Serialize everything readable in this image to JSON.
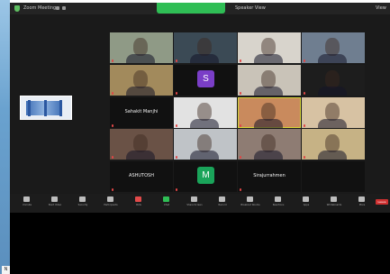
{
  "window": {
    "title": "Zoom Meeting",
    "speaker_view_label": "Speaker View",
    "view_label": "View"
  },
  "gallery": {
    "tiles": [
      {
        "kind": "video",
        "name": "",
        "bg": "#8f9a86"
      },
      {
        "kind": "video",
        "name": "",
        "bg": "#3b4a55"
      },
      {
        "kind": "video",
        "name": "",
        "bg": "#d8d4cc"
      },
      {
        "kind": "video",
        "name": "",
        "bg": "#6f7e90"
      },
      {
        "kind": "video",
        "name": "",
        "bg": "#a28a5c"
      },
      {
        "kind": "avatar",
        "initial": "S",
        "avatar_color": "#7a3ec7",
        "name": ""
      },
      {
        "kind": "video",
        "name": "",
        "bg": "#c9c3b8"
      },
      {
        "kind": "video",
        "name": "",
        "bg": "#1d1d1d"
      },
      {
        "kind": "text",
        "name": "",
        "display": "Sahakit Manjhi"
      },
      {
        "kind": "video",
        "name": "",
        "bg": "#e2e2e2"
      },
      {
        "kind": "video",
        "name": "",
        "bg": "#c98a5d",
        "active": true
      },
      {
        "kind": "video",
        "name": "",
        "bg": "#d7c2a3"
      },
      {
        "kind": "video",
        "name": "",
        "bg": "#6a5246"
      },
      {
        "kind": "video",
        "name": "",
        "bg": "#bfc3c7"
      },
      {
        "kind": "video",
        "name": "",
        "bg": "#8e7c73"
      },
      {
        "kind": "video",
        "name": "",
        "bg": "#c6b285"
      },
      {
        "kind": "text",
        "name": "",
        "display": "ASHUTOSH"
      },
      {
        "kind": "avatar",
        "initial": "M",
        "avatar_color": "#1aa45a",
        "name": ""
      },
      {
        "kind": "text",
        "name": "",
        "display": "Sirajurrahmen"
      },
      {
        "kind": "empty",
        "name": ""
      }
    ]
  },
  "controls": {
    "items": [
      {
        "label": "Unmute",
        "icon": "microphone-icon"
      },
      {
        "label": "Start Video",
        "icon": "camera-icon"
      },
      {
        "label": "Security",
        "icon": "shield-icon"
      },
      {
        "label": "Participants",
        "icon": "participants-icon"
      },
      {
        "label": "Polls",
        "icon": "check-icon"
      },
      {
        "label": "Chat",
        "icon": "chat-icon"
      },
      {
        "label": "Share Screen",
        "icon": "share-screen-icon"
      },
      {
        "label": "Record",
        "icon": "record-icon"
      },
      {
        "label": "Breakout Rooms",
        "icon": "breakout-rooms-icon"
      },
      {
        "label": "Reactions",
        "icon": "smile-icon"
      },
      {
        "label": "Apps",
        "icon": "apps-icon"
      },
      {
        "label": "Whiteboards",
        "icon": "whiteboard-icon"
      },
      {
        "label": "More",
        "icon": "more-icon"
      }
    ],
    "leave_label": "Leave",
    "accent_colors": {
      "polls": "#e24a4a",
      "chat": "#2fbe55",
      "leave": "#d03131"
    }
  }
}
